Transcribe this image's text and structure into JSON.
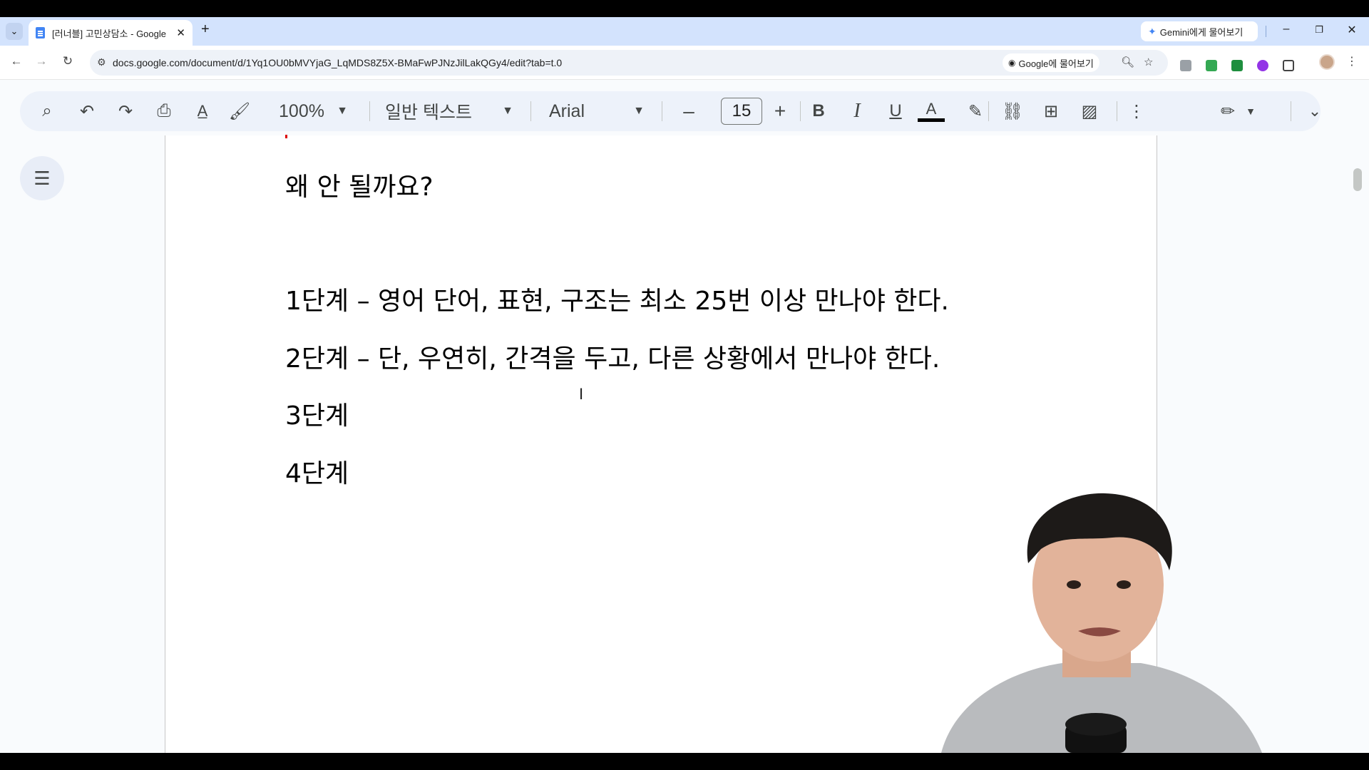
{
  "browser": {
    "tab_title": "[러너블] 고민상담소 - Google",
    "url": "docs.google.com/document/d/1Yq1OU0bMVYjaG_LqMDS8Z5X-BMaFwPJNzJilLakQGy4/edit?tab=t.0",
    "gemini_label": "Gemini에게 물어보기",
    "ask_google_label": "Google에 물어보기"
  },
  "toolbar": {
    "zoom": "100%",
    "style": "일반 텍스트",
    "font": "Arial",
    "font_size": "15"
  },
  "document": {
    "lines": [
      "왜 안 될까요?",
      "1단계 – 영어 단어, 표현, 구조는 최소 25번 이상 만나야 한다.",
      "2단계 – 단, 우연히, 간격을 두고, 다른 상황에서 만나야 한다.",
      "3단계",
      "4단계"
    ]
  },
  "icons": {
    "colors": {
      "accent": "#4285f4",
      "text_color_bar": "#000000",
      "toolbar_bg": "#edf2fa"
    }
  }
}
